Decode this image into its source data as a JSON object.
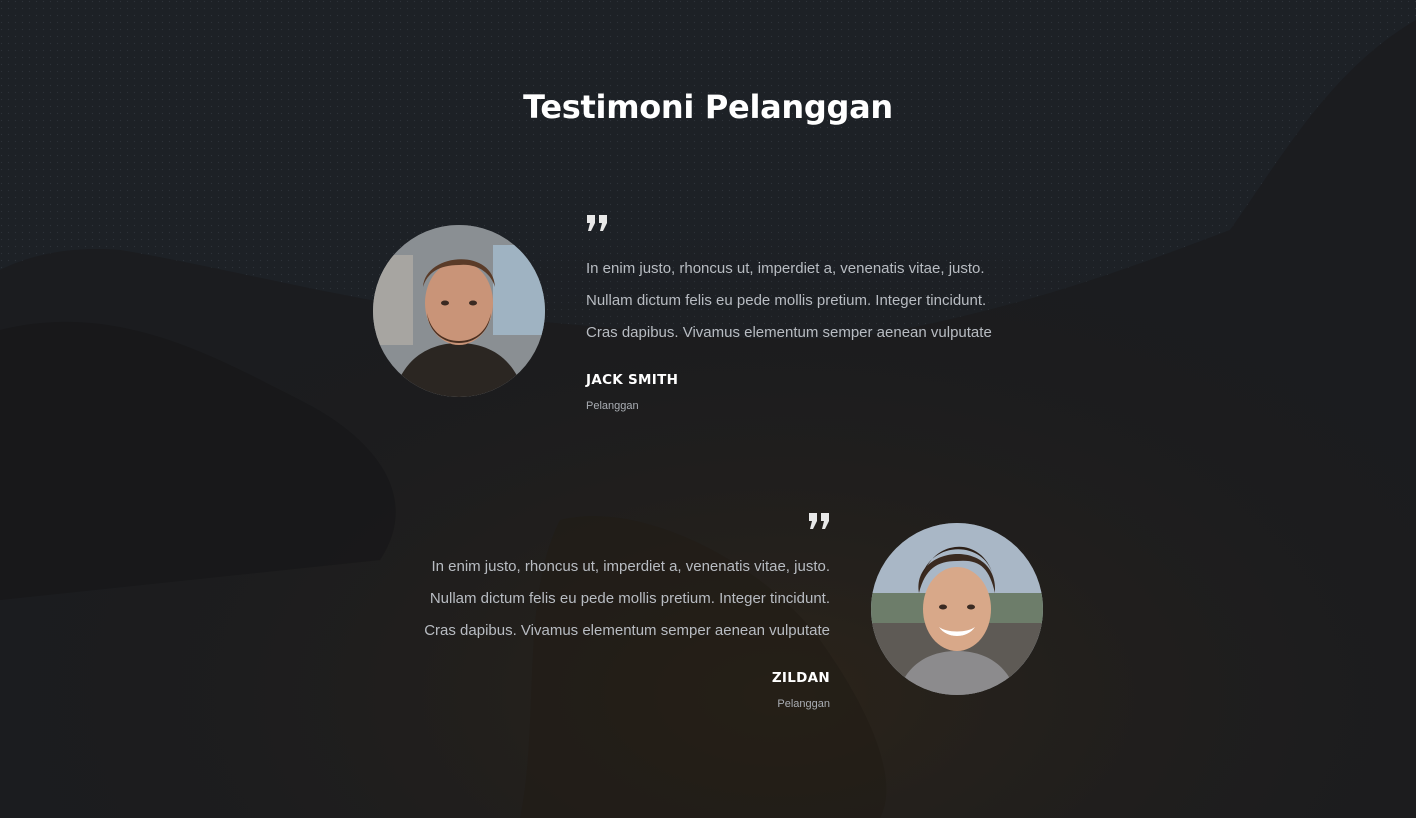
{
  "section": {
    "title": "Testimoni Pelanggan"
  },
  "testimonials": [
    {
      "quote_lines": [
        "In enim justo, rhoncus ut, imperdiet a, venenatis vitae, justo.",
        "Nullam dictum felis eu pede mollis pretium. Integer tincidunt.",
        "Cras dapibus. Vivamus elementum semper aenean vulputate"
      ],
      "name": "JACK SMITH",
      "role": "Pelanggan",
      "avatar_icon": "bearded-man-avatar",
      "quote_icon": "quote-icon"
    },
    {
      "quote_lines": [
        "In enim justo, rhoncus ut, imperdiet a, venenatis vitae, justo.",
        "Nullam dictum felis eu pede mollis pretium. Integer tincidunt.",
        "Cras dapibus. Vivamus elementum semper aenean vulputate"
      ],
      "name": "ZILDAN",
      "role": "Pelanggan",
      "avatar_icon": "smiling-young-man-avatar",
      "quote_icon": "quote-icon"
    }
  ],
  "colors": {
    "background": "#1a1b1d",
    "title": "#ffffff",
    "body_text": "#b8bcc2",
    "name": "#ffffff",
    "role": "#a9adb3",
    "quote_mark": "#e8e8e8"
  }
}
